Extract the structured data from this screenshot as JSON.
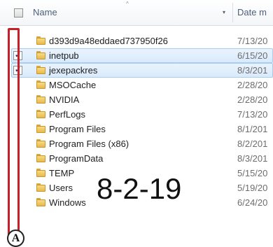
{
  "header": {
    "name_label": "Name",
    "date_label": "Date m",
    "sort_indicator": "^",
    "dropdown_indicator": "▾"
  },
  "rows": [
    {
      "name": "d393d9a48eddaed737950f26",
      "date": "7/13/20",
      "selected": false,
      "checked": false
    },
    {
      "name": "inetpub",
      "date": "6/15/20",
      "selected": true,
      "checked": true
    },
    {
      "name": "jexepackres",
      "date": "8/3/201",
      "selected": true,
      "checked": true
    },
    {
      "name": "MSOCache",
      "date": "2/28/20",
      "selected": false,
      "checked": false
    },
    {
      "name": "NVIDIA",
      "date": "2/28/20",
      "selected": false,
      "checked": false
    },
    {
      "name": "PerfLogs",
      "date": "7/13/20",
      "selected": false,
      "checked": false
    },
    {
      "name": "Program Files",
      "date": "8/1/201",
      "selected": false,
      "checked": false
    },
    {
      "name": "Program Files (x86)",
      "date": "8/2/201",
      "selected": false,
      "checked": false
    },
    {
      "name": "ProgramData",
      "date": "8/3/201",
      "selected": false,
      "checked": false
    },
    {
      "name": "TEMP",
      "date": "5/15/20",
      "selected": false,
      "checked": false
    },
    {
      "name": "Users",
      "date": "5/19/20",
      "selected": false,
      "checked": false
    },
    {
      "name": "Windows",
      "date": "6/24/20",
      "selected": false,
      "checked": false
    }
  ],
  "annotation": {
    "marker_label": "A",
    "handwritten_date": "8-2-19",
    "highlight_color": "#c8202a"
  },
  "icons": {
    "checkmark": "✓",
    "folder": "folder-icon"
  }
}
